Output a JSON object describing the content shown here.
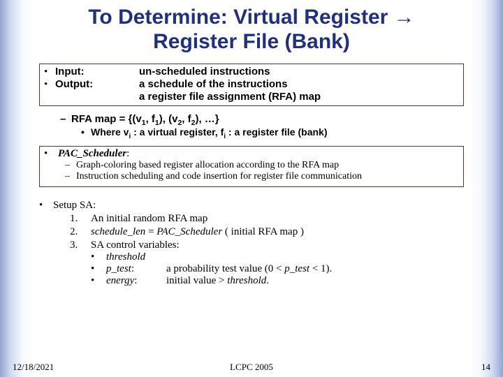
{
  "title_line1": "To Determine: Virtual Register →",
  "title_line2": "Register File (Bank)",
  "io": {
    "input_label": "Input:",
    "input_desc": "un-scheduled instructions",
    "output_label": "Output:",
    "output_desc1": "a schedule of the instructions",
    "output_desc2": "a register file assignment (RFA) map"
  },
  "rfa": {
    "line_prefix": "RFA map = {(v",
    "line_mid1": ", f",
    "line_mid2": "), (v",
    "line_mid3": ", f",
    "line_suffix": "), …}",
    "sub_prefix": "Where   v",
    "sub_mid1": " : a virtual register,   f",
    "sub_suffix": " : a register file (bank)"
  },
  "sched": {
    "name": "PAC_Scheduler",
    "colon": ":",
    "b1": "Graph-coloring based register allocation according to the RFA map",
    "b2": "Instruction scheduling and code insertion for register file communication"
  },
  "sa": {
    "header": "Setup SA:",
    "i1": "An initial random RFA map",
    "i2a": "schedule_len",
    "i2b": " = ",
    "i2c": "PAC_Scheduler",
    "i2d": " ( initial RFA map )",
    "i3": "SA control variables:",
    "v1": "threshold",
    "v2a": "p_test",
    "v2b": ":",
    "v2c": "a probability test value  (0 < ",
    "v2d": "p_test",
    "v2e": " < 1).",
    "v3a": "energy",
    "v3b": ":",
    "v3c": "initial value > ",
    "v3d": "threshold",
    "v3e": "."
  },
  "footer": {
    "date": "12/18/2021",
    "venue": "LCPC 2005",
    "page": "14"
  }
}
